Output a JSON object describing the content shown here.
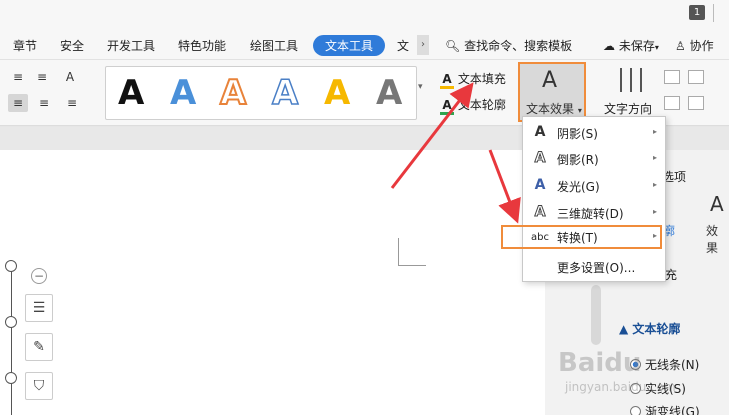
{
  "titlebar": {
    "page_badge": "1"
  },
  "menu": {
    "tabs": [
      "章节",
      "安全",
      "开发工具",
      "特色功能",
      "绘图工具",
      "文本工具",
      "文"
    ],
    "active_tab": "文本工具",
    "more": "›",
    "search": "查找命令、搜索模板",
    "unsaved": "未保存",
    "collab": "协作"
  },
  "ribbon": {
    "align_buttons": [
      "≡",
      "≡",
      "A",
      "≡",
      "≡",
      "≡"
    ],
    "gallery_letters": [
      {
        "char": "A",
        "style": "black"
      },
      {
        "char": "A",
        "style": "blue-gradient"
      },
      {
        "char": "A",
        "style": "orange-outline"
      },
      {
        "char": "A",
        "style": "blue-outline"
      },
      {
        "char": "A",
        "style": "yellow"
      },
      {
        "char": "A",
        "style": "gray-gradient"
      }
    ],
    "text_fill": "文本填充",
    "text_outline": "文本轮廓",
    "text_effect": "文本效果",
    "text_direction": "文字方向",
    "colors": {
      "accent": "#2f7bd9",
      "highlight": "#f08c3b",
      "arrow": "#e8383d"
    }
  },
  "dropdown": {
    "items": [
      {
        "icon": "shadow-icon",
        "label": "阴影(S)",
        "submenu": true
      },
      {
        "icon": "reflection-icon",
        "label": "倒影(R)",
        "submenu": true
      },
      {
        "icon": "glow-icon",
        "label": "发光(G)",
        "submenu": true
      },
      {
        "icon": "3d-rotation-icon",
        "label": "三维旋转(D)",
        "submenu": true
      },
      {
        "icon": "transform-icon",
        "label": "转换(T)",
        "submenu": true,
        "highlighted": true
      },
      {
        "icon": "",
        "label": "更多设置(O)...",
        "submenu": false
      }
    ],
    "transform_icon_text": "abc"
  },
  "panel": {
    "tab_partial": "选项",
    "tab_blue": "廓",
    "effect_partial": "效果",
    "fill_partial": "充",
    "section": "文本轮廓",
    "radios": [
      {
        "label": "无线条(N)",
        "checked": true
      },
      {
        "label": "实线(S)",
        "checked": false
      },
      {
        "label": "渐变线(G)",
        "checked": false
      }
    ]
  },
  "watermark": {
    "brand": "Baidu",
    "sub": "jingyan.baidu.com"
  }
}
